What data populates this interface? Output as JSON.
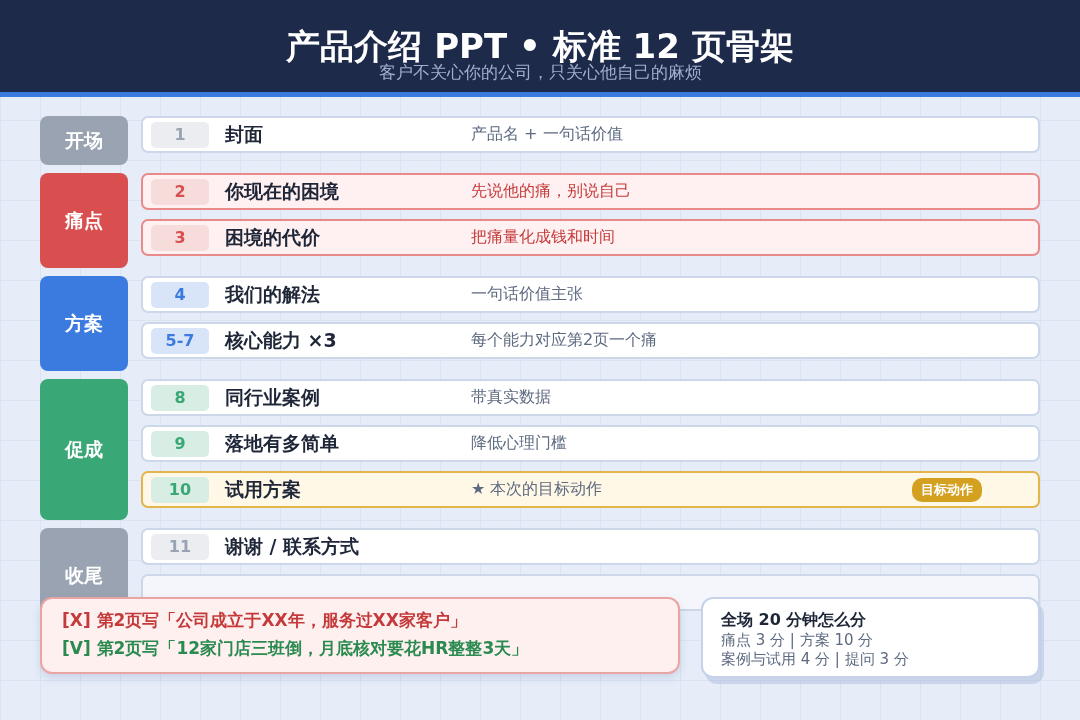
{
  "header": {
    "title": "产品介绍 PPT • 标准 12 页骨架",
    "subtitle": "客户不关心你的公司，只关心他自己的麻烦"
  },
  "groups": [
    {
      "label": "开场",
      "color": "#9aa3b2",
      "rows": [
        {
          "kind": "plain",
          "number": "1",
          "title": "封面",
          "note": "产品名 + 一句话价值"
        }
      ]
    },
    {
      "label": "痛点",
      "color": "#d94f4f",
      "rows": [
        {
          "kind": "pain",
          "number": "2",
          "title": "你现在的困境",
          "note": "先说他的痛，别说自己"
        },
        {
          "kind": "pain",
          "number": "3",
          "title": "困境的代价",
          "note": "把痛量化成钱和时间"
        }
      ]
    },
    {
      "label": "方案",
      "color": "#3b7be0",
      "rows": [
        {
          "kind": "plain",
          "number": "4",
          "title": "我们的解法",
          "note": "一句话价值主张"
        },
        {
          "kind": "plain",
          "number": "5-7",
          "title": "核心能力 ×3",
          "note": "每个能力对应第2页一个痛"
        }
      ]
    },
    {
      "label": "促成",
      "color": "#3aa776",
      "rows": [
        {
          "kind": "plain",
          "number": "8",
          "title": "同行业案例",
          "note": "带真实数据"
        },
        {
          "kind": "plain",
          "number": "9",
          "title": "落地有多简单",
          "note": "降低心理门槛"
        },
        {
          "kind": "target",
          "number": "10",
          "title": "试用方案",
          "note": "★ 本次的目标动作",
          "badge": "目标动作"
        }
      ]
    },
    {
      "label": "收尾",
      "color": "#9aa3b2",
      "rows": [
        {
          "kind": "plain",
          "number": "11",
          "title": "谢谢 / 联系方式"
        },
        {
          "kind": "covered"
        }
      ]
    }
  ],
  "callout": {
    "lines": [
      {
        "kind": "bad",
        "text": "[X] 第2页写「公司成立于XX年，服务过XX家客户」"
      },
      {
        "kind": "good",
        "text": "[V] 第2页写「12家门店三班倒，月底核对要花HR整整3天」"
      }
    ]
  },
  "summary": {
    "title": "全场 20 分钟怎么分",
    "lines": [
      "痛点 3 分 | 方案 10 分",
      "案例与试用 4 分 | 提问 3 分"
    ]
  }
}
